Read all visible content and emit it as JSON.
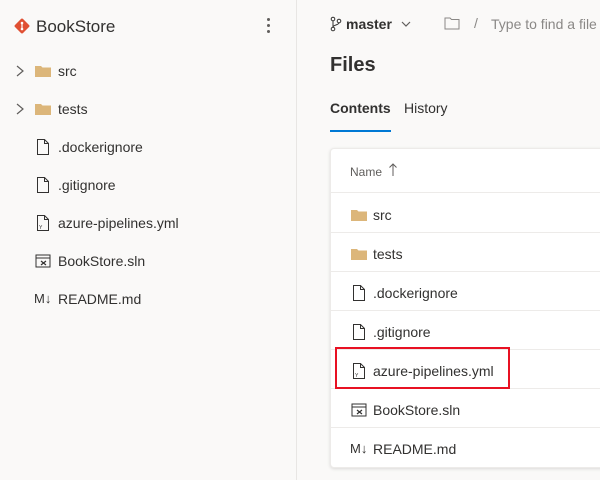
{
  "repo": {
    "name": "BookStore",
    "logo_color": "#e05033"
  },
  "sidebar": {
    "items": [
      {
        "label": "src",
        "type": "folder",
        "expandable": true
      },
      {
        "label": "tests",
        "type": "folder",
        "expandable": true
      },
      {
        "label": ".dockerignore",
        "type": "file"
      },
      {
        "label": ".gitignore",
        "type": "file"
      },
      {
        "label": "azure-pipelines.yml",
        "type": "yaml-file"
      },
      {
        "label": "BookStore.sln",
        "type": "solution-file"
      },
      {
        "label": "README.md",
        "type": "markdown-file",
        "icon_text": "M↓"
      }
    ]
  },
  "header": {
    "branch": "master",
    "path_placeholder": "Type to find a file or folder...",
    "separator": "/"
  },
  "page_title": "Files",
  "tabs": [
    {
      "label": "Contents",
      "active": true
    },
    {
      "label": "History",
      "active": false
    }
  ],
  "table": {
    "column_name": "Name",
    "sort_indicator": "↑",
    "rows": [
      {
        "label": "src",
        "type": "folder"
      },
      {
        "label": "tests",
        "type": "folder"
      },
      {
        "label": ".dockerignore",
        "type": "file"
      },
      {
        "label": ".gitignore",
        "type": "file"
      },
      {
        "label": "azure-pipelines.yml",
        "type": "yaml-file",
        "highlighted": true
      },
      {
        "label": "BookStore.sln",
        "type": "solution-file"
      },
      {
        "label": "README.md",
        "type": "markdown-file",
        "icon_text": "M↓"
      }
    ]
  },
  "colors": {
    "accent": "#0078d4",
    "folder": "#dcb67a",
    "highlight": "#e81123"
  }
}
